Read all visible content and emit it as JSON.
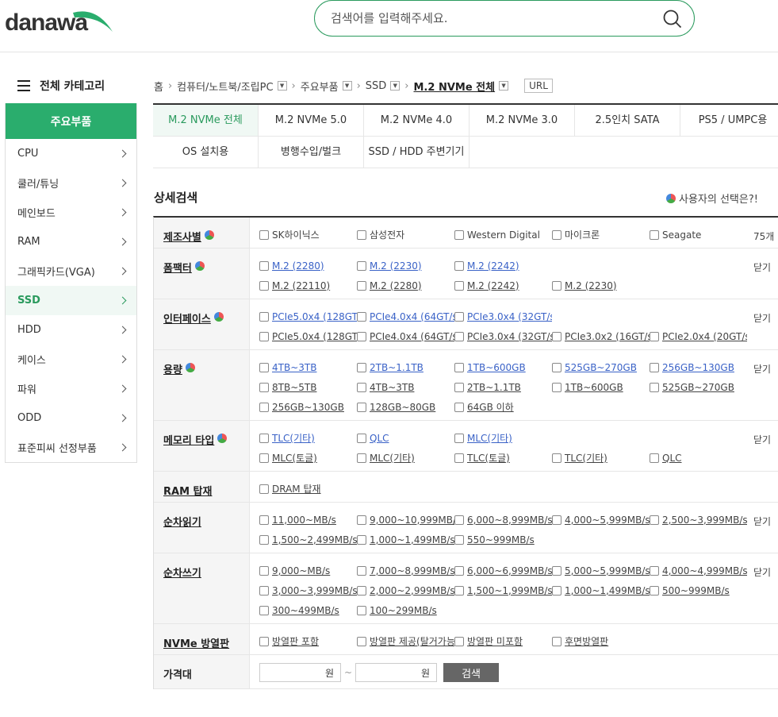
{
  "header": {
    "logo": "danawa",
    "search_placeholder": "검색어를 입력해주세요."
  },
  "sidebar": {
    "all_categories": "전체 카테고리",
    "title": "주요부품",
    "items": [
      {
        "label": "CPU"
      },
      {
        "label": "쿨러/튜닝"
      },
      {
        "label": "메인보드"
      },
      {
        "label": "RAM"
      },
      {
        "label": "그래픽카드(VGA)"
      },
      {
        "label": "SSD",
        "active": true
      },
      {
        "label": "HDD"
      },
      {
        "label": "케이스"
      },
      {
        "label": "파워"
      },
      {
        "label": "ODD"
      },
      {
        "label": "표준피씨 선정부품"
      }
    ]
  },
  "breadcrumb": {
    "items": [
      "홈",
      "컴퓨터/노트북/조립PC",
      "주요부품",
      "SSD",
      "M.2 NVMe 전체"
    ],
    "url_label": "URL"
  },
  "tabs": {
    "row1": [
      "M.2 NVMe 전체",
      "M.2 NVMe 5.0",
      "M.2 NVMe 4.0",
      "M.2 NVMe 3.0",
      "2.5인치 SATA",
      "PS5 / UMPC용"
    ],
    "row2": [
      "OS 설치용",
      "병행수입/벌크",
      "SSD / HDD 주변기기"
    ]
  },
  "detail_search": {
    "title": "상세검색",
    "user_choice": "사용자의 선택은?!",
    "close_label": "닫기"
  },
  "specs": [
    {
      "label": "제조사별",
      "dot": true,
      "extra": "75개",
      "options": [
        {
          "t": "SK하이닉스"
        },
        {
          "t": "삼성전자"
        },
        {
          "t": "Western Digital"
        },
        {
          "t": "마이크론"
        },
        {
          "t": "Seagate"
        }
      ]
    },
    {
      "label": "폼팩터",
      "dot": true,
      "extra": "닫기",
      "options": [
        {
          "t": "M.2 (2280)",
          "link": true
        },
        {
          "t": "M.2 (2230)",
          "link": true
        },
        {
          "t": "M.2 (2242)",
          "link": true
        },
        {
          "t": "",
          "blank": true
        },
        {
          "t": "",
          "blank": true
        },
        {
          "t": "M.2 (22110)",
          "u": true
        },
        {
          "t": "M.2 (2280)",
          "u": true
        },
        {
          "t": "M.2 (2242)",
          "u": true
        },
        {
          "t": "M.2 (2230)",
          "u": true
        }
      ]
    },
    {
      "label": "인터페이스",
      "dot": true,
      "extra": "닫기",
      "options": [
        {
          "t": "PCIe5.0x4 (128GT/s)",
          "link": true
        },
        {
          "t": "PCIe4.0x4 (64GT/s)",
          "link": true
        },
        {
          "t": "PCIe3.0x4 (32GT/s)",
          "link": true
        },
        {
          "t": "",
          "blank": true
        },
        {
          "t": "",
          "blank": true
        },
        {
          "t": "PCIe5.0x4 (128GT/s)",
          "u": true
        },
        {
          "t": "PCIe4.0x4 (64GT/s)",
          "u": true
        },
        {
          "t": "PCIe3.0x4 (32GT/s)",
          "u": true
        },
        {
          "t": "PCIe3.0x2 (16GT/s)",
          "u": true
        },
        {
          "t": "PCIe2.0x4 (20GT/s)",
          "u": true
        }
      ]
    },
    {
      "label": "용량",
      "dot": true,
      "extra": "닫기",
      "options": [
        {
          "t": "4TB~3TB",
          "link": true
        },
        {
          "t": "2TB~1.1TB",
          "link": true
        },
        {
          "t": "1TB~600GB",
          "link": true
        },
        {
          "t": "525GB~270GB",
          "link": true
        },
        {
          "t": "256GB~130GB",
          "link": true
        },
        {
          "t": "8TB~5TB",
          "u": true
        },
        {
          "t": "4TB~3TB",
          "u": true
        },
        {
          "t": "2TB~1.1TB",
          "u": true
        },
        {
          "t": "1TB~600GB",
          "u": true
        },
        {
          "t": "525GB~270GB",
          "u": true
        },
        {
          "t": "256GB~130GB",
          "u": true
        },
        {
          "t": "128GB~80GB",
          "u": true
        },
        {
          "t": "64GB 이하",
          "u": true
        }
      ]
    },
    {
      "label": "메모리 타입",
      "dot": true,
      "extra": "닫기",
      "options": [
        {
          "t": "TLC(기타)",
          "link": true
        },
        {
          "t": "QLC",
          "link": true
        },
        {
          "t": "MLC(기타)",
          "link": true
        },
        {
          "t": "",
          "blank": true
        },
        {
          "t": "",
          "blank": true
        },
        {
          "t": "MLC(토글)",
          "u": true
        },
        {
          "t": "MLC(기타)",
          "u": true
        },
        {
          "t": "TLC(토글)",
          "u": true
        },
        {
          "t": "TLC(기타)",
          "u": true
        },
        {
          "t": "QLC",
          "u": true
        }
      ]
    },
    {
      "label": "RAM 탑재",
      "dot": false,
      "extra": "",
      "options": [
        {
          "t": "DRAM 탑재",
          "u": true
        }
      ]
    },
    {
      "label": "순차읽기",
      "dot": false,
      "extra": "닫기",
      "options": [
        {
          "t": "11,000~MB/s",
          "u": true
        },
        {
          "t": "9,000~10,999MB/s",
          "u": true
        },
        {
          "t": "6,000~8,999MB/s",
          "u": true
        },
        {
          "t": "4,000~5,999MB/s",
          "u": true
        },
        {
          "t": "2,500~3,999MB/s",
          "u": true
        },
        {
          "t": "1,500~2,499MB/s",
          "u": true
        },
        {
          "t": "1,000~1,499MB/s",
          "u": true
        },
        {
          "t": "550~999MB/s",
          "u": true
        }
      ]
    },
    {
      "label": "순차쓰기",
      "dot": false,
      "extra": "닫기",
      "options": [
        {
          "t": "9,000~MB/s",
          "u": true
        },
        {
          "t": "7,000~8,999MB/s",
          "u": true
        },
        {
          "t": "6,000~6,999MB/s",
          "u": true
        },
        {
          "t": "5,000~5,999MB/s",
          "u": true
        },
        {
          "t": "4,000~4,999MB/s",
          "u": true
        },
        {
          "t": "3,000~3,999MB/s",
          "u": true
        },
        {
          "t": "2,000~2,999MB/s",
          "u": true
        },
        {
          "t": "1,500~1,999MB/s",
          "u": true
        },
        {
          "t": "1,000~1,499MB/s",
          "u": true
        },
        {
          "t": "500~999MB/s",
          "u": true
        },
        {
          "t": "300~499MB/s",
          "u": true
        },
        {
          "t": "100~299MB/s",
          "u": true
        }
      ]
    },
    {
      "label": "NVMe 방열판",
      "dot": false,
      "extra": "",
      "options": [
        {
          "t": "방열판 포함",
          "u": true
        },
        {
          "t": "방열판 제공(탈거가능)",
          "u": true
        },
        {
          "t": "방열판 미포함",
          "u": true
        },
        {
          "t": "후면방열판",
          "u": true
        }
      ]
    }
  ],
  "price": {
    "label": "가격대",
    "unit": "원",
    "tilde": "~",
    "button": "검색"
  }
}
